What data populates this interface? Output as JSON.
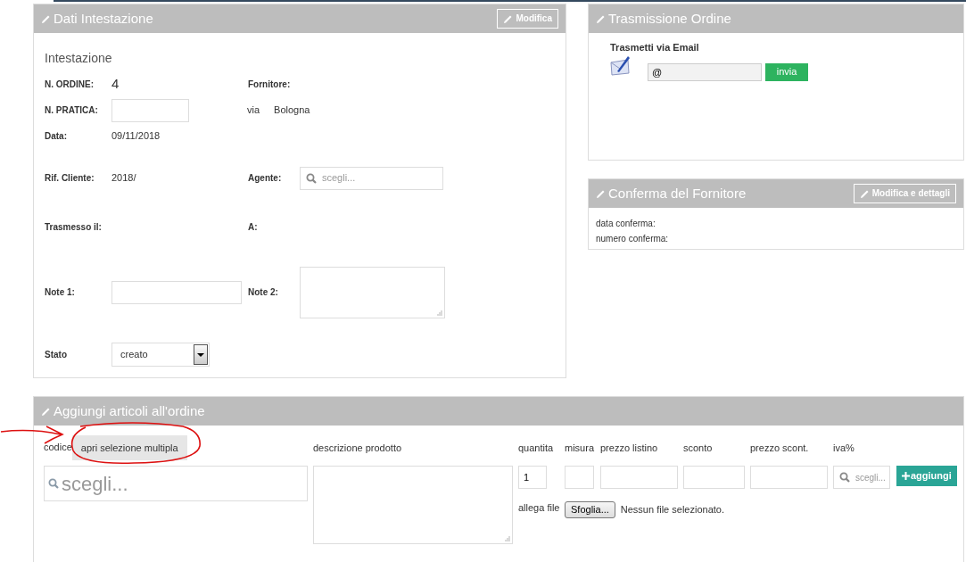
{
  "header_panel": {
    "title": "Dati Intestazione",
    "edit_button": "Modifica",
    "section_title": "Intestazione",
    "rows": [
      {
        "left": {
          "label": "N. ORDINE:",
          "kind": "number",
          "value": "4"
        },
        "right": {
          "label": "Fornitore:",
          "kind": "empty"
        }
      },
      {
        "left": {
          "label": "N. PRATICA:",
          "kind": "input"
        },
        "right": {
          "kind": "address",
          "parts": [
            "via",
            "Bologna"
          ]
        }
      },
      {
        "left": {
          "label": "Data:",
          "kind": "text",
          "value": "09/11/2018"
        }
      },
      {
        "left": {
          "label": "Rif. Cliente:",
          "kind": "text",
          "value": "2018/"
        },
        "right": {
          "label": "Agente:",
          "kind": "search",
          "placeholder": "scegli..."
        }
      },
      {
        "left": {
          "label": "Trasmesso il:",
          "kind": "empty"
        },
        "right": {
          "label": "A:",
          "kind": "empty"
        }
      },
      {
        "left": {
          "label": "Note 1:",
          "kind": "input"
        },
        "right": {
          "label": "Note 2:",
          "kind": "textarea"
        }
      },
      {
        "left": {
          "label": "Stato",
          "kind": "select",
          "value": "creato"
        }
      }
    ]
  },
  "transmission_panel": {
    "title": "Trasmissione Ordine",
    "heading": "Trasmetti via Email",
    "email": {
      "value": "@"
    },
    "send_button": "invia"
  },
  "confirmation_panel": {
    "title": "Conferma del Fornitore",
    "edit_button": "Modifica e dettagli",
    "lines": [
      "data conferma:",
      "numero conferma:"
    ]
  },
  "add_items_panel": {
    "title": "Aggiungi articoli all'ordine",
    "code_label": "codice",
    "multi_select_button": "apri selezione multipla",
    "code_search": {
      "placeholder": "scegli..."
    },
    "description_label": "descrizione prodotto",
    "columns": [
      {
        "label": "quantita",
        "kind": "input",
        "value": "1"
      },
      {
        "label": "misura",
        "kind": "input"
      },
      {
        "label": "prezzo listino",
        "kind": "input"
      },
      {
        "label": "sconto",
        "kind": "input"
      },
      {
        "label": "prezzo scont.",
        "kind": "input"
      },
      {
        "label": "iva%",
        "kind": "search",
        "placeholder": "scegli..."
      }
    ],
    "add_button": "aggiungi",
    "attach_label": "allega file",
    "browse_button": "Sfoglia...",
    "file_status": "Nessun file selezionato."
  }
}
